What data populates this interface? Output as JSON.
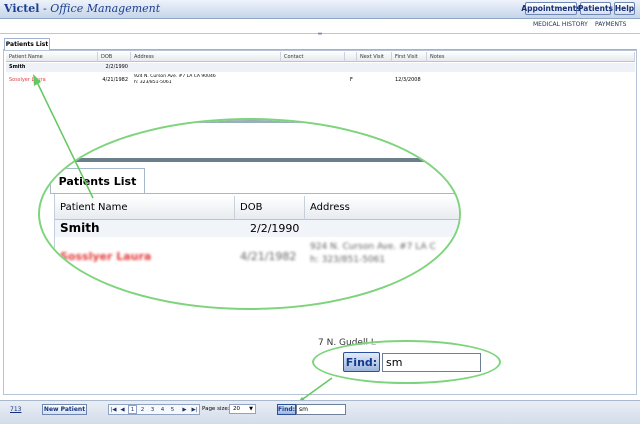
{
  "app": {
    "brand": "Victel",
    "title_suffix": "Office Management"
  },
  "top_buttons": [
    "Appointments",
    "Patients",
    "Help"
  ],
  "sub_links": [
    "MEDICAL HISTORY",
    "PAYMENTS"
  ],
  "tab": {
    "label": "Patients List"
  },
  "grid": {
    "columns": [
      "Patient Name",
      "DOB",
      "Address",
      "Contact",
      "",
      "Next Visit",
      "First Visit",
      "Notes"
    ],
    "rows": [
      {
        "name": "Smith",
        "dob": "2/2/1990",
        "address1": "",
        "address2": "",
        "contact": "",
        "flag": "",
        "next_visit": "",
        "first_visit": "",
        "notes": ""
      },
      {
        "name": "Sosslyer Laura",
        "dob": "4/21/1982",
        "address1": "924 N. Curson Ave. #7 LA CA 90046",
        "address2": "h: 323/851-5061",
        "contact": "",
        "flag": "F",
        "next_visit": "",
        "first_visit": "12/3/2008",
        "notes": ""
      }
    ]
  },
  "zoom": {
    "tab_label": "Patients List",
    "columns": [
      "Patient Name",
      "DOB",
      "Address"
    ],
    "rows": [
      {
        "name": "Smith",
        "dob": "2/2/1990",
        "address1": "",
        "address2": ""
      },
      {
        "name": "Sosslyer Laura",
        "dob": "4/21/1982",
        "address1": "924 N. Curson Ave. #7 LA C",
        "address2": "h: 323/851-5061"
      }
    ],
    "find_label": "Find:",
    "find_value": "sm",
    "behind_text": "7 N. Gudell L"
  },
  "pager": {
    "record_count": "713",
    "new_patient_label": "New Patient",
    "first": "|◀",
    "prev": "◀",
    "next": "▶",
    "last": "▶|",
    "pages": [
      "1",
      "2",
      "3",
      "4",
      "5"
    ],
    "current_page": "1",
    "page_size_label": "Page size:",
    "page_size_value": "20",
    "find_label": "Find:",
    "find_value": "sm"
  },
  "colors": {
    "accent": "#1c3f8f",
    "highlight": "#7ed47c",
    "alert_name": "#e53b3b"
  }
}
